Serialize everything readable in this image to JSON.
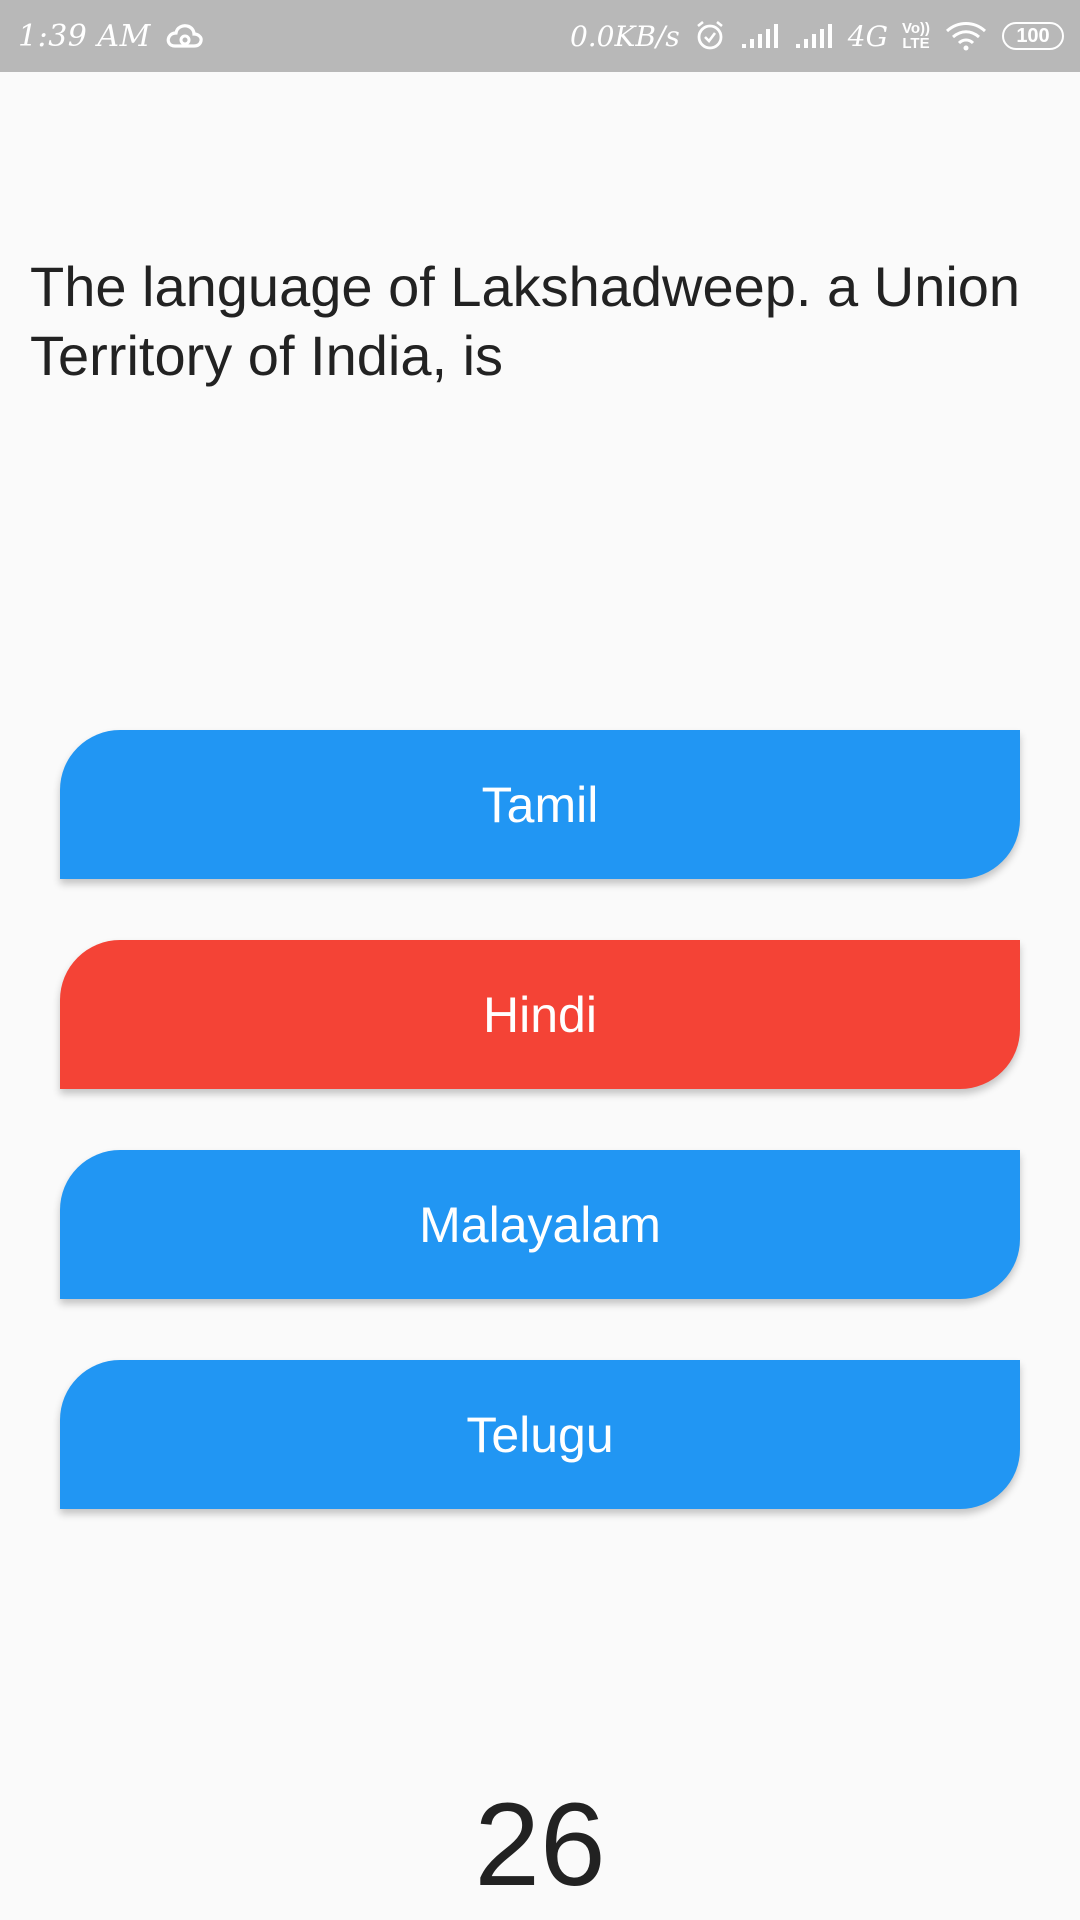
{
  "status_bar": {
    "time": "1:39 AM",
    "net_speed": "0.0KB/s",
    "network_type": "4G",
    "volte_top": "Vo))",
    "volte_bottom": "LTE",
    "battery": "100",
    "icons": [
      "cloud-icon",
      "alarm-icon",
      "signal-icon",
      "signal-icon",
      "wifi-icon",
      "battery-icon"
    ]
  },
  "question": {
    "text": "The language of Lakshadweep. a Union Territory of India, is"
  },
  "answers": [
    {
      "label": "Tamil",
      "color": "#2196f3"
    },
    {
      "label": "Hindi",
      "color": "#f44336"
    },
    {
      "label": "Malayalam",
      "color": "#2196f3"
    },
    {
      "label": "Telugu",
      "color": "#2196f3"
    }
  ],
  "timer": {
    "value": "26"
  },
  "colors": {
    "status_bar": "#b8b8b8",
    "background": "#fafafa",
    "primary_blue": "#2196f3",
    "selected_red": "#f44336",
    "text_dark": "#222222"
  }
}
